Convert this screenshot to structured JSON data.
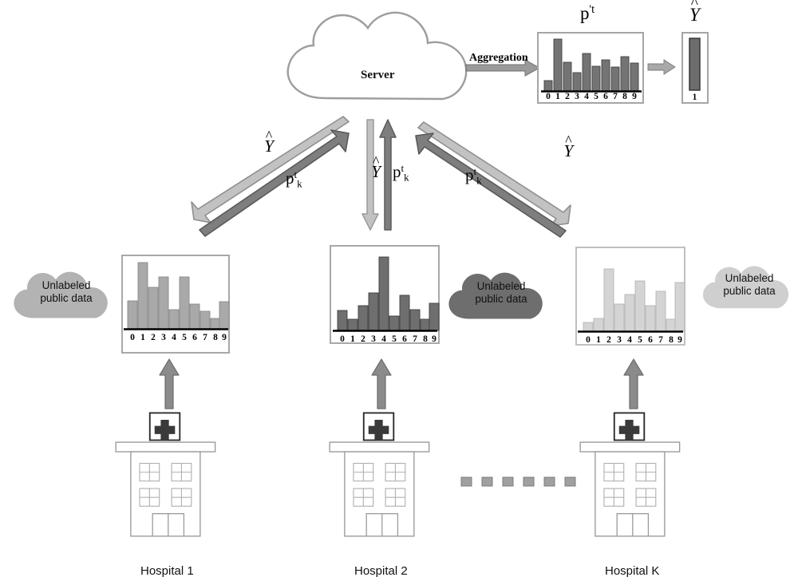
{
  "diagram": {
    "title_semantic": "federated-learning-with-unlabeled-public-data",
    "server": {
      "label": "Server"
    },
    "aggregation": {
      "label": "Aggregation"
    },
    "server_output": {
      "hist_label_base": "p",
      "hist_label_sup": "'t",
      "result_label_base": "Y",
      "result_bar_tick": "1"
    },
    "edges": {
      "down_label": "Y",
      "up_label_base": "p",
      "up_label_sup": "t",
      "up_label_sub": "k"
    },
    "clouds": [
      {
        "line1": "Unlabeled",
        "line2": "public data",
        "fill": "#b3b3b3"
      },
      {
        "line1": "Unlabeled",
        "line2": "public data",
        "fill": "#6e6e6e"
      },
      {
        "line1": "Unlabeled",
        "line2": "public data",
        "fill": "#cfcfcf"
      }
    ],
    "hospitals": [
      {
        "label": "Hospital 1",
        "cross": "+"
      },
      {
        "label": "Hospital 2",
        "cross": "+"
      },
      {
        "label": "Hospital K",
        "cross": "+"
      }
    ],
    "ellipsis_dots": 6,
    "colors": {
      "bar_light": "#a8a8a8",
      "bar_mid": "#6f6f6f",
      "bar_pale": "#d2d2d2",
      "arrow_dark": "#707070",
      "arrow_light": "#b5b5b5",
      "outline": "#8c8c8c",
      "axis": "#000000"
    }
  },
  "chart_data": [
    {
      "type": "bar",
      "name": "server-aggregated-histogram",
      "title": "p''t",
      "categories": [
        "0",
        "1",
        "2",
        "3",
        "4",
        "5",
        "6",
        "7",
        "8",
        "9"
      ],
      "values": [
        12,
        75,
        42,
        27,
        55,
        36,
        46,
        35,
        50,
        41
      ],
      "ylim": [
        0,
        80
      ],
      "grid": false,
      "xlabel": "",
      "ylabel": ""
    },
    {
      "type": "bar",
      "name": "server-argmax-output",
      "title": "Y-hat",
      "categories": [
        "1"
      ],
      "values": [
        100
      ],
      "ylim": [
        0,
        100
      ],
      "grid": false,
      "xlabel": "",
      "ylabel": ""
    },
    {
      "type": "bar",
      "name": "hospital-1-histogram",
      "title": "",
      "categories": [
        "0",
        "1",
        "2",
        "3",
        "4",
        "5",
        "6",
        "7",
        "8",
        "9"
      ],
      "values": [
        42,
        82,
        55,
        70,
        28,
        70,
        38,
        26,
        12,
        41
      ],
      "ylim": [
        0,
        90
      ],
      "grid": false,
      "xlabel": "",
      "ylabel": ""
    },
    {
      "type": "bar",
      "name": "hospital-2-histogram",
      "title": "",
      "categories": [
        "0",
        "1",
        "2",
        "3",
        "4",
        "5",
        "6",
        "7",
        "8",
        "9"
      ],
      "values": [
        25,
        14,
        36,
        52,
        90,
        16,
        50,
        29,
        14,
        40
      ],
      "ylim": [
        0,
        95
      ],
      "grid": false,
      "xlabel": "",
      "ylabel": ""
    },
    {
      "type": "bar",
      "name": "hospital-k-histogram",
      "title": "",
      "categories": [
        "0",
        "1",
        "2",
        "3",
        "4",
        "5",
        "6",
        "7",
        "8",
        "9"
      ],
      "values": [
        8,
        13,
        82,
        33,
        44,
        68,
        31,
        54,
        15,
        66
      ],
      "ylim": [
        0,
        90
      ],
      "grid": false,
      "xlabel": "",
      "ylabel": ""
    }
  ]
}
